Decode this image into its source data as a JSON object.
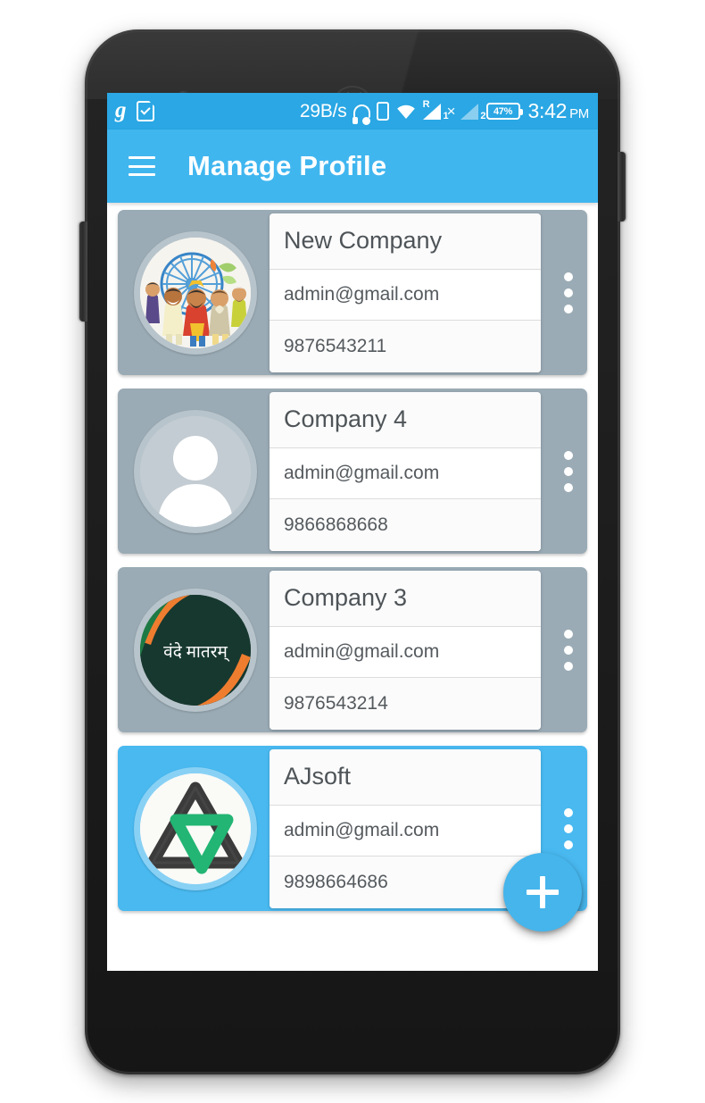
{
  "status_bar": {
    "left_icons": [
      {
        "name": "gaana-app-icon",
        "glyph": "g"
      },
      {
        "name": "note-check-icon",
        "glyph": "note"
      }
    ],
    "network_speed": "29B/s",
    "icons": [
      {
        "name": "headset-icon"
      },
      {
        "name": "sd-card-icon"
      },
      {
        "name": "wifi-icon"
      },
      {
        "name": "sim1-signal-icon",
        "label": "R",
        "index": "1"
      },
      {
        "name": "sim2-signal-icon",
        "label": "",
        "index": "2"
      }
    ],
    "sim_separator": "×",
    "sim1_roaming": "R",
    "sim1_index": "1",
    "sim2_index": "2",
    "battery_percent": "47%",
    "time": "3:42",
    "time_period": "PM"
  },
  "app_bar": {
    "menu_icon": "hamburger-icon",
    "title": "Manage Profile"
  },
  "profiles": [
    {
      "name": "New Company",
      "email": "admin@gmail.com",
      "phone": "9876543211",
      "avatar": "indian-celebration-illustration",
      "selected": false
    },
    {
      "name": "Company 4",
      "email": "admin@gmail.com",
      "phone": "9866868668",
      "avatar": "default-person-placeholder",
      "selected": false
    },
    {
      "name": "Company 3",
      "email": "admin@gmail.com",
      "phone": "9876543214",
      "avatar": "vande-mataram-flag-logo",
      "selected": false
    },
    {
      "name": "AJsoft",
      "email": "admin@gmail.com",
      "phone": "9898664686",
      "avatar": "ajsoft-triangle-logo",
      "selected": true
    }
  ],
  "overflow_menu_icon": "kebab-menu-icon",
  "fab": {
    "icon": "plus-icon",
    "label": "+"
  },
  "colors": {
    "status_bar": "#2aa7e4",
    "app_bar": "#40b6ef",
    "card": "#9aabb5",
    "card_selected": "#49b9f0",
    "fab": "#45b5ec",
    "field_bg": "#fbfbfb",
    "text": "#555a5e"
  }
}
